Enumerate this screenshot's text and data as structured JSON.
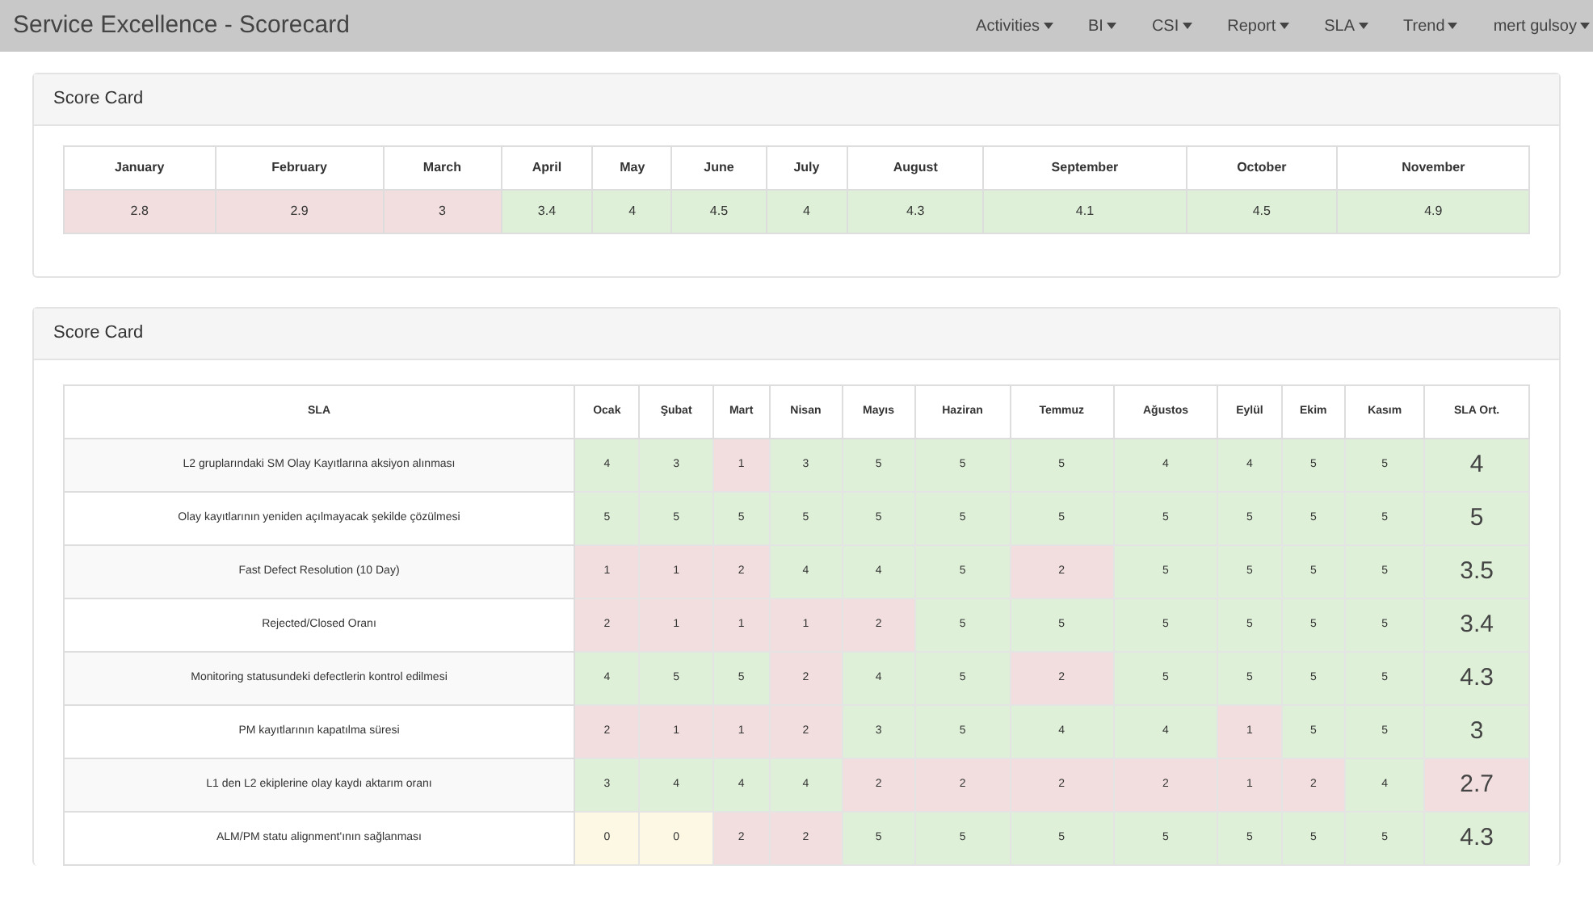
{
  "navbar": {
    "title": "Service Excellence - Scorecard",
    "menus": [
      "Activities",
      "BI",
      "CSI",
      "Report",
      "SLA",
      "Trend",
      "mert gulsoy"
    ]
  },
  "monthly_panel": {
    "title": "Score Card",
    "columns": [
      "January",
      "February",
      "March",
      "April",
      "May",
      "June",
      "July",
      "August",
      "September",
      "October",
      "November"
    ],
    "cells": [
      {
        "value": "2.8",
        "color": "#f2dede"
      },
      {
        "value": "2.9",
        "color": "#f2dede"
      },
      {
        "value": "3",
        "color": "#f2dede"
      },
      {
        "value": "3.4",
        "color": "#dff0d8"
      },
      {
        "value": "4",
        "color": "#dff0d8"
      },
      {
        "value": "4.5",
        "color": "#dff0d8"
      },
      {
        "value": "4",
        "color": "#dff0d8"
      },
      {
        "value": "4.3",
        "color": "#dff0d8"
      },
      {
        "value": "4.1",
        "color": "#dff0d8"
      },
      {
        "value": "4.5",
        "color": "#dff0d8"
      },
      {
        "value": "4.9",
        "color": "#dff0d8"
      }
    ]
  },
  "sla_panel": {
    "title": "Score Card",
    "columns": [
      "SLA",
      "Ocak",
      "Şubat",
      "Mart",
      "Nisan",
      "Mayıs",
      "Haziran",
      "Temmuz",
      "Ağustos",
      "Eylül",
      "Ekim",
      "Kasım",
      "SLA Ort."
    ],
    "rows": [
      {
        "cells": [
          {
            "value": "L2 gruplarındaki SM Olay Kayıtlarına aksiyon alınması"
          },
          {
            "value": "4",
            "color": "#dff0d8"
          },
          {
            "value": "3",
            "color": "#dff0d8"
          },
          {
            "value": "1",
            "color": "#f2dede"
          },
          {
            "value": "3",
            "color": "#dff0d8"
          },
          {
            "value": "5",
            "color": "#dff0d8"
          },
          {
            "value": "5",
            "color": "#dff0d8"
          },
          {
            "value": "5",
            "color": "#dff0d8"
          },
          {
            "value": "4",
            "color": "#dff0d8"
          },
          {
            "value": "4",
            "color": "#dff0d8"
          },
          {
            "value": "5",
            "color": "#dff0d8"
          },
          {
            "value": "5",
            "color": "#dff0d8"
          },
          {
            "value": "4",
            "color": "#dff0d8"
          }
        ]
      },
      {
        "cells": [
          {
            "value": "Olay kayıtlarının yeniden açılmayacak şekilde çözülmesi"
          },
          {
            "value": "5",
            "color": "#dff0d8"
          },
          {
            "value": "5",
            "color": "#dff0d8"
          },
          {
            "value": "5",
            "color": "#dff0d8"
          },
          {
            "value": "5",
            "color": "#dff0d8"
          },
          {
            "value": "5",
            "color": "#dff0d8"
          },
          {
            "value": "5",
            "color": "#dff0d8"
          },
          {
            "value": "5",
            "color": "#dff0d8"
          },
          {
            "value": "5",
            "color": "#dff0d8"
          },
          {
            "value": "5",
            "color": "#dff0d8"
          },
          {
            "value": "5",
            "color": "#dff0d8"
          },
          {
            "value": "5",
            "color": "#dff0d8"
          },
          {
            "value": "5",
            "color": "#dff0d8"
          }
        ]
      },
      {
        "cells": [
          {
            "value": "Fast Defect Resolution (10 Day)"
          },
          {
            "value": "1",
            "color": "#f2dede"
          },
          {
            "value": "1",
            "color": "#f2dede"
          },
          {
            "value": "2",
            "color": "#f2dede"
          },
          {
            "value": "4",
            "color": "#dff0d8"
          },
          {
            "value": "4",
            "color": "#dff0d8"
          },
          {
            "value": "5",
            "color": "#dff0d8"
          },
          {
            "value": "2",
            "color": "#f2dede"
          },
          {
            "value": "5",
            "color": "#dff0d8"
          },
          {
            "value": "5",
            "color": "#dff0d8"
          },
          {
            "value": "5",
            "color": "#dff0d8"
          },
          {
            "value": "5",
            "color": "#dff0d8"
          },
          {
            "value": "3.5",
            "color": "#dff0d8"
          }
        ]
      },
      {
        "cells": [
          {
            "value": "Rejected/Closed Oranı"
          },
          {
            "value": "2",
            "color": "#f2dede"
          },
          {
            "value": "1",
            "color": "#f2dede"
          },
          {
            "value": "1",
            "color": "#f2dede"
          },
          {
            "value": "1",
            "color": "#f2dede"
          },
          {
            "value": "2",
            "color": "#f2dede"
          },
          {
            "value": "5",
            "color": "#dff0d8"
          },
          {
            "value": "5",
            "color": "#dff0d8"
          },
          {
            "value": "5",
            "color": "#dff0d8"
          },
          {
            "value": "5",
            "color": "#dff0d8"
          },
          {
            "value": "5",
            "color": "#dff0d8"
          },
          {
            "value": "5",
            "color": "#dff0d8"
          },
          {
            "value": "3.4",
            "color": "#dff0d8"
          }
        ]
      },
      {
        "cells": [
          {
            "value": "Monitoring statusundeki defectlerin kontrol edilmesi"
          },
          {
            "value": "4",
            "color": "#dff0d8"
          },
          {
            "value": "5",
            "color": "#dff0d8"
          },
          {
            "value": "5",
            "color": "#dff0d8"
          },
          {
            "value": "2",
            "color": "#f2dede"
          },
          {
            "value": "4",
            "color": "#dff0d8"
          },
          {
            "value": "5",
            "color": "#dff0d8"
          },
          {
            "value": "2",
            "color": "#f2dede"
          },
          {
            "value": "5",
            "color": "#dff0d8"
          },
          {
            "value": "5",
            "color": "#dff0d8"
          },
          {
            "value": "5",
            "color": "#dff0d8"
          },
          {
            "value": "5",
            "color": "#dff0d8"
          },
          {
            "value": "4.3",
            "color": "#dff0d8"
          }
        ]
      },
      {
        "cells": [
          {
            "value": "PM kayıtlarının kapatılma süresi"
          },
          {
            "value": "2",
            "color": "#f2dede"
          },
          {
            "value": "1",
            "color": "#f2dede"
          },
          {
            "value": "1",
            "color": "#f2dede"
          },
          {
            "value": "2",
            "color": "#f2dede"
          },
          {
            "value": "3",
            "color": "#dff0d8"
          },
          {
            "value": "5",
            "color": "#dff0d8"
          },
          {
            "value": "4",
            "color": "#dff0d8"
          },
          {
            "value": "4",
            "color": "#dff0d8"
          },
          {
            "value": "1",
            "color": "#f2dede"
          },
          {
            "value": "5",
            "color": "#dff0d8"
          },
          {
            "value": "5",
            "color": "#dff0d8"
          },
          {
            "value": "3",
            "color": "#dff0d8"
          }
        ]
      },
      {
        "cells": [
          {
            "value": "L1 den L2 ekiplerine olay kaydı aktarım oranı"
          },
          {
            "value": "3",
            "color": "#dff0d8"
          },
          {
            "value": "4",
            "color": "#dff0d8"
          },
          {
            "value": "4",
            "color": "#dff0d8"
          },
          {
            "value": "4",
            "color": "#dff0d8"
          },
          {
            "value": "2",
            "color": "#f2dede"
          },
          {
            "value": "2",
            "color": "#f2dede"
          },
          {
            "value": "2",
            "color": "#f2dede"
          },
          {
            "value": "2",
            "color": "#f2dede"
          },
          {
            "value": "1",
            "color": "#f2dede"
          },
          {
            "value": "2",
            "color": "#f2dede"
          },
          {
            "value": "4",
            "color": "#dff0d8"
          },
          {
            "value": "2.7",
            "color": "#f2dede"
          }
        ]
      },
      {
        "cells": [
          {
            "value": "ALM/PM statu alignment'ının sağlanması"
          },
          {
            "value": "0",
            "color": "#fcf8e3"
          },
          {
            "value": "0",
            "color": "#fcf8e3"
          },
          {
            "value": "2",
            "color": "#f2dede"
          },
          {
            "value": "2",
            "color": "#f2dede"
          },
          {
            "value": "5",
            "color": "#dff0d8"
          },
          {
            "value": "5",
            "color": "#dff0d8"
          },
          {
            "value": "5",
            "color": "#dff0d8"
          },
          {
            "value": "5",
            "color": "#dff0d8"
          },
          {
            "value": "5",
            "color": "#dff0d8"
          },
          {
            "value": "5",
            "color": "#dff0d8"
          },
          {
            "value": "5",
            "color": "#dff0d8"
          },
          {
            "value": "4.3",
            "color": "#dff0d8"
          }
        ]
      }
    ]
  }
}
